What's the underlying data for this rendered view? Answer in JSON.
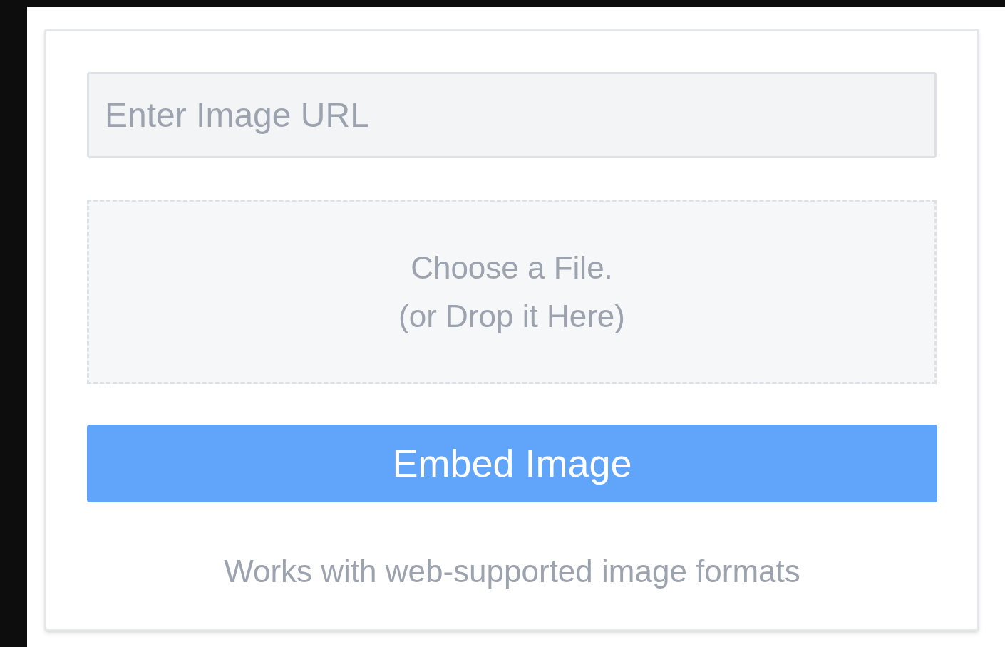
{
  "url_field": {
    "placeholder": "Enter Image URL"
  },
  "dropzone": {
    "lines": [
      "Choose a File.",
      "(or Drop it Here)"
    ]
  },
  "embed_button": {
    "label": "Embed Image"
  },
  "note": "Works with web-supported image formats"
}
